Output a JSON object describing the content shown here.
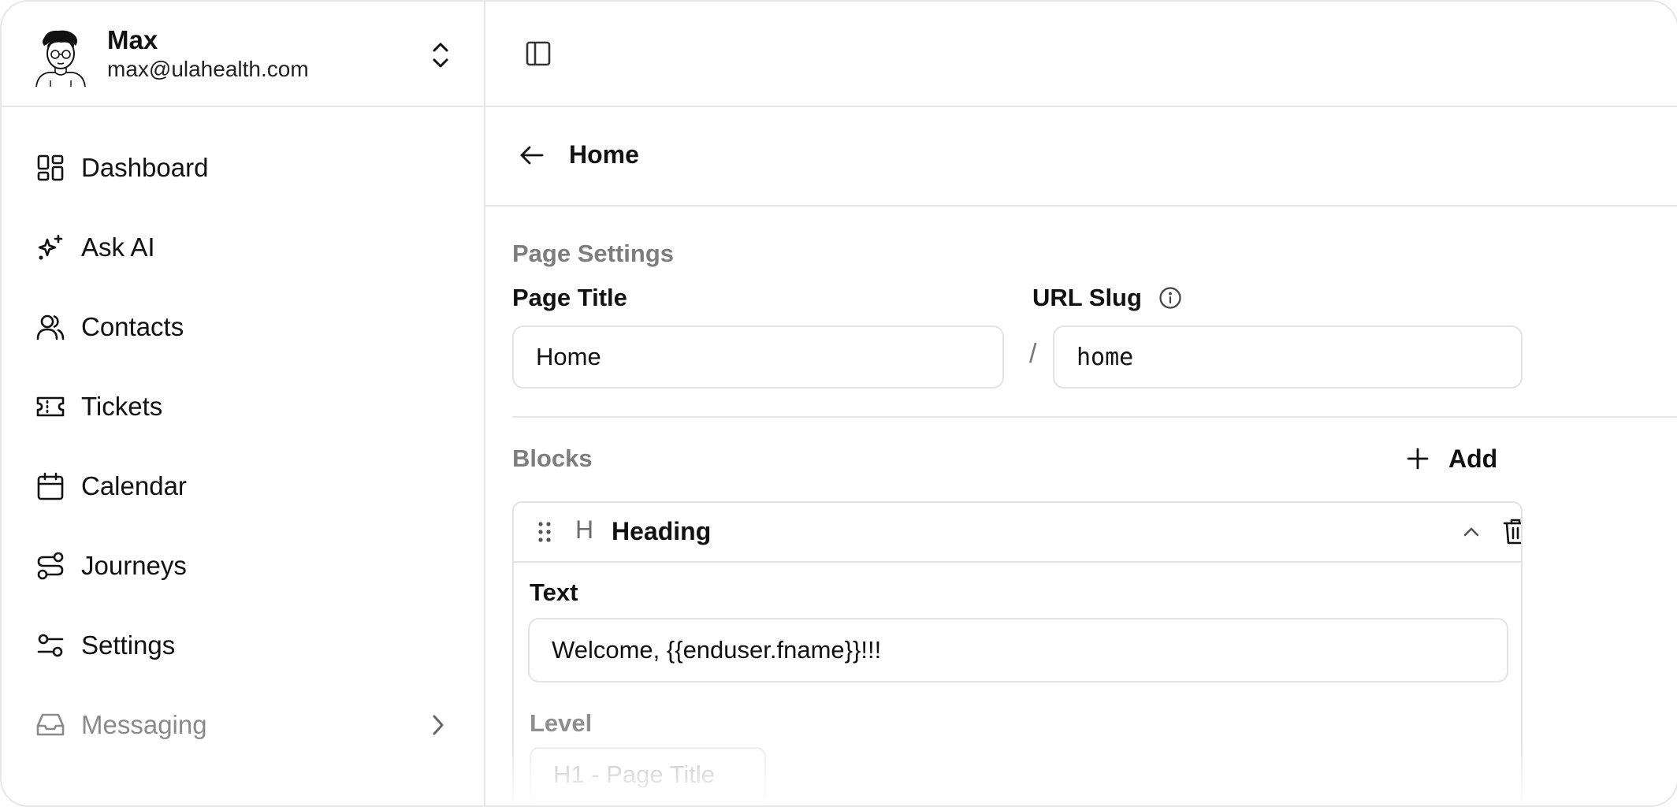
{
  "user": {
    "name": "Max",
    "email": "max@ulahealth.com"
  },
  "sidebar": {
    "items": [
      {
        "label": "Dashboard",
        "icon": "dashboard-icon"
      },
      {
        "label": "Ask AI",
        "icon": "sparkles-icon"
      },
      {
        "label": "Contacts",
        "icon": "users-icon"
      },
      {
        "label": "Tickets",
        "icon": "ticket-icon"
      },
      {
        "label": "Calendar",
        "icon": "calendar-icon"
      },
      {
        "label": "Journeys",
        "icon": "route-icon"
      },
      {
        "label": "Settings",
        "icon": "sliders-icon"
      },
      {
        "label": "Messaging",
        "icon": "inbox-icon"
      }
    ]
  },
  "header": {
    "title": "Home"
  },
  "page_settings": {
    "section_title": "Page Settings",
    "page_title_label": "Page Title",
    "page_title_value": "Home",
    "url_slug_label": "URL Slug",
    "url_slug_prefix": "/",
    "url_slug_value": "home"
  },
  "blocks": {
    "section_title": "Blocks",
    "add_label": "Add",
    "items": [
      {
        "type_icon": "H",
        "title": "Heading",
        "text_label": "Text",
        "text_value": "Welcome, {{enduser.fname}}!!!",
        "level_label": "Level",
        "level_value": "H1 - Page Title"
      }
    ]
  }
}
